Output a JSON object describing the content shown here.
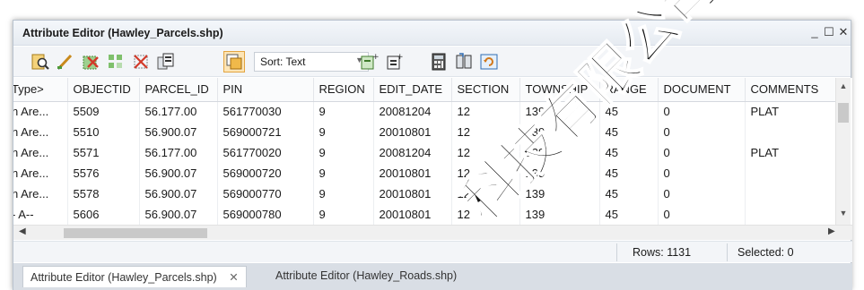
{
  "window": {
    "title": "Attribute Editor (Hawley_Parcels.shp)",
    "minimize_glyph": "_",
    "maximize_glyph": "☐",
    "close_glyph": "✕"
  },
  "toolbar": {
    "sort_label": "Sort: Text",
    "sort_arrow": "▼"
  },
  "table": {
    "headers": [
      "Type>",
      "OBJECTID",
      "PARCEL_ID",
      "PIN",
      "REGION",
      "EDIT_DATE",
      "SECTION",
      "TOWNSHIP",
      "RANGE",
      "DOCUMENT",
      "COMMENTS"
    ],
    "rows": [
      [
        "n Are...",
        "5509",
        "56.177.00",
        "561770030",
        "9",
        "20081204",
        "12",
        "139",
        "45",
        "0",
        "PLAT"
      ],
      [
        "n Are...",
        "5510",
        "56.900.07",
        "569000721",
        "9",
        "20010801",
        "12",
        "139",
        "45",
        "0",
        ""
      ],
      [
        "n Are...",
        "5571",
        "56.177.00",
        "561770020",
        "9",
        "20081204",
        "12",
        "139",
        "45",
        "0",
        "PLAT"
      ],
      [
        "n Are...",
        "5576",
        "56.900.07",
        "569000720",
        "9",
        "20010801",
        "12",
        "139",
        "45",
        "0",
        ""
      ],
      [
        "n Are...",
        "5578",
        "56.900.07",
        "569000770",
        "9",
        "20010801",
        "12",
        "139",
        "45",
        "0",
        ""
      ],
      [
        "- A-- ",
        "5606",
        "56.900.07",
        "569000780",
        "9",
        "20010801",
        "12",
        "139",
        "45",
        "0",
        ""
      ]
    ]
  },
  "status": {
    "rows": "Rows: 1131",
    "selected": "Selected: 0"
  },
  "tabs": [
    {
      "label": "Attribute Editor (Hawley_Parcels.shp)",
      "close": "✕"
    },
    {
      "label": "Attribute Editor (Hawley_Roads.shp)"
    }
  ],
  "watermark": "科技有限公司"
}
